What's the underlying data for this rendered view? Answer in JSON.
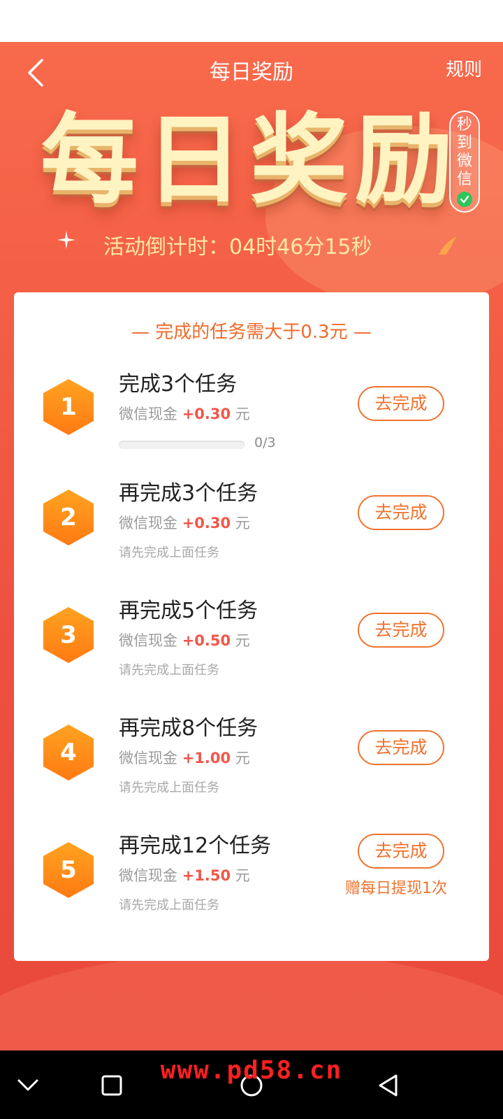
{
  "nav": {
    "title": "每日奖励",
    "rules_label": "规则",
    "back_icon": "chevron-left-icon"
  },
  "hero": {
    "title_chars": [
      "每",
      "日",
      "奖",
      "励"
    ],
    "badge_text": "秒到微信",
    "countdown": "活动倒计时：04时46分15秒"
  },
  "card": {
    "header": "— 完成的任务需大于0.3元 —",
    "tasks": [
      {
        "num": "1",
        "title": "完成3个任务",
        "reward_prefix": "微信现金 ",
        "amount": "+0.30",
        "unit": " 元",
        "progress_text": "0/3",
        "progress": 0,
        "button": "去完成"
      },
      {
        "num": "2",
        "title": "再完成3个任务",
        "reward_prefix": "微信现金 ",
        "amount": "+0.30",
        "unit": " 元",
        "sub": "请先完成上面任务",
        "button": "去完成"
      },
      {
        "num": "3",
        "title": "再完成5个任务",
        "reward_prefix": "微信现金 ",
        "amount": "+0.50",
        "unit": " 元",
        "sub": "请先完成上面任务",
        "button": "去完成"
      },
      {
        "num": "4",
        "title": "再完成8个任务",
        "reward_prefix": "微信现金 ",
        "amount": "+1.00",
        "unit": " 元",
        "sub": "请先完成上面任务",
        "button": "去完成"
      },
      {
        "num": "5",
        "title": "再完成12个任务",
        "reward_prefix": "微信现金 ",
        "amount": "+1.50",
        "unit": " 元",
        "sub": "请先完成上面任务",
        "button": "去完成",
        "bonus": "赠每日提现1次"
      }
    ]
  },
  "colors": {
    "accent": "#f0732e",
    "reward": "#f2564a",
    "background": "#f35d44"
  },
  "system_nav": {
    "icons": [
      "chevron-down-icon",
      "square-icon",
      "circle-icon",
      "triangle-back-icon"
    ]
  },
  "watermark": "www.pd58.cn"
}
